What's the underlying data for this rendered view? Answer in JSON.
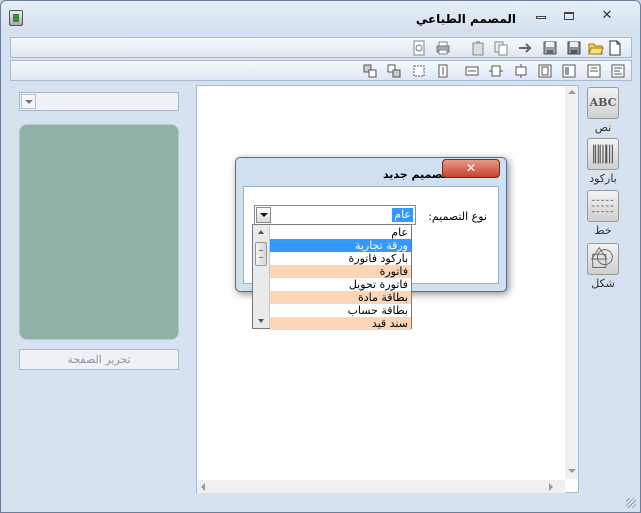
{
  "window": {
    "title": "المصمم الطباعي",
    "close_glyph": "✕"
  },
  "toolbar1": {
    "icons": [
      "new-page-icon",
      "open-folder-icon",
      "save-icon",
      "save-as-icon",
      "cut-icon",
      "copy-icon",
      "paste-icon",
      "print-icon",
      "print-preview-icon"
    ]
  },
  "toolbar2": {
    "icons": [
      "align-left-icon",
      "align-right-icon",
      "align-top-icon",
      "align-bottom-icon",
      "center-horizontal-icon",
      "center-vertical-icon",
      "same-width-icon",
      "same-height-icon",
      "same-size-icon",
      "bring-front-icon",
      "send-back-icon"
    ]
  },
  "left_panel": {
    "page_select_value": "",
    "edit_page_button": "تحرير الصفحة"
  },
  "side_tools": {
    "text": {
      "abc": "ABC",
      "label": "نص"
    },
    "barcode": {
      "label": "باركود"
    },
    "line": {
      "label": "خط"
    },
    "shape": {
      "label": "شكل"
    }
  },
  "dialog": {
    "title": "تصميم جديد",
    "close_glyph": "✕",
    "design_type_label": "نوع التصميم:",
    "selected_value": "عام",
    "options": [
      {
        "label": "عام",
        "state": "normal"
      },
      {
        "label": "ورقة تجارية",
        "state": "selected"
      },
      {
        "label": "باركود فاتورة",
        "state": "normal"
      },
      {
        "label": "فاتورة",
        "state": "alt"
      },
      {
        "label": "فاتورة تحويل",
        "state": "normal"
      },
      {
        "label": "بطاقة مادة",
        "state": "alt"
      },
      {
        "label": "بطاقة حساب",
        "state": "normal"
      },
      {
        "label": "سند قيد",
        "state": "alt"
      }
    ]
  },
  "colors": {
    "window_bg": "#d6e2f0",
    "preview_panel": "#8fb1a7",
    "selection": "#3399ff",
    "alt_row": "#fbd5b5",
    "close_red": "#c6432c"
  }
}
